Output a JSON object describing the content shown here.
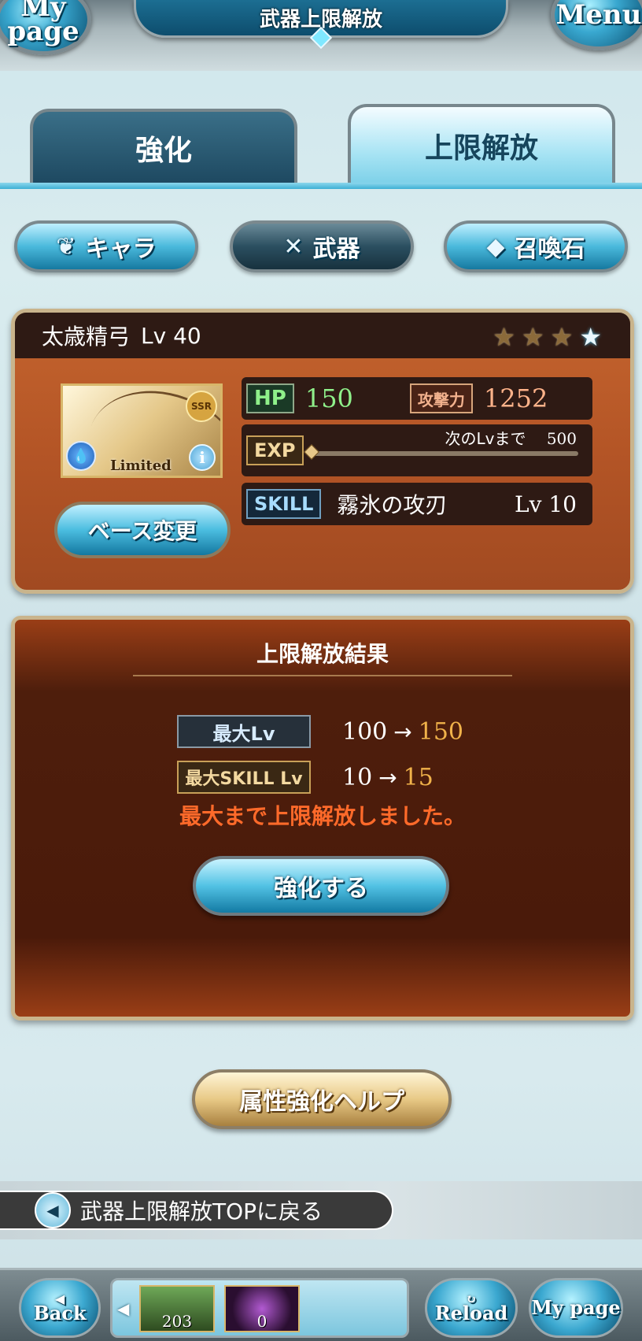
{
  "header": {
    "title": "武器上限解放",
    "mypage_label": "My page",
    "menu_label": "Menu"
  },
  "tabs": [
    {
      "label": "強化",
      "active": false
    },
    {
      "label": "上限解放",
      "active": true
    }
  ],
  "categories": [
    {
      "label": "キャラ",
      "icon": "character-icon",
      "active": false
    },
    {
      "label": "武器",
      "icon": "crossed-swords-icon",
      "active": true
    },
    {
      "label": "召喚石",
      "icon": "crystal-icon",
      "active": false
    }
  ],
  "weapon": {
    "name": "太歳精弓",
    "level_label": "Lv 40",
    "stars_total": 4,
    "stars_lit": 1,
    "rarity": "SSR",
    "element": "water",
    "card_label": "Limited",
    "hp_tag": "HP",
    "hp": "150",
    "atk_tag": "攻撃力",
    "atk": "1252",
    "exp_tag": "EXP",
    "exp_next_label": "次のLvまで",
    "exp_next_value": "500",
    "exp_progress": 0,
    "skill_tag": "SKILL",
    "skill_name": "霧氷の攻刃",
    "skill_level": "Lv 10",
    "base_change_label": "ベース変更"
  },
  "result": {
    "title": "上限解放結果",
    "rows": [
      {
        "label": "最大Lv",
        "from": "100",
        "arrow": "→",
        "to": "150"
      },
      {
        "label": "最大SKILL Lv",
        "from": "10",
        "arrow": "→",
        "to": "15"
      }
    ],
    "message": "最大まで上限解放しました。",
    "button_label": "強化する"
  },
  "help_label": "属性強化ヘルプ",
  "back_link_label": "武器上限解放TOPに戻る",
  "bottom_nav": {
    "back_label": "Back",
    "reload_label": "Reload",
    "mypage_label": "My page",
    "items": [
      {
        "count": "203"
      },
      {
        "count": "0"
      }
    ]
  },
  "colors": {
    "accent_blue": "#4ab9dc",
    "panel_brown": "#b45526",
    "result_orange": "#ff6a2a",
    "level_gold": "#f0b24a"
  }
}
